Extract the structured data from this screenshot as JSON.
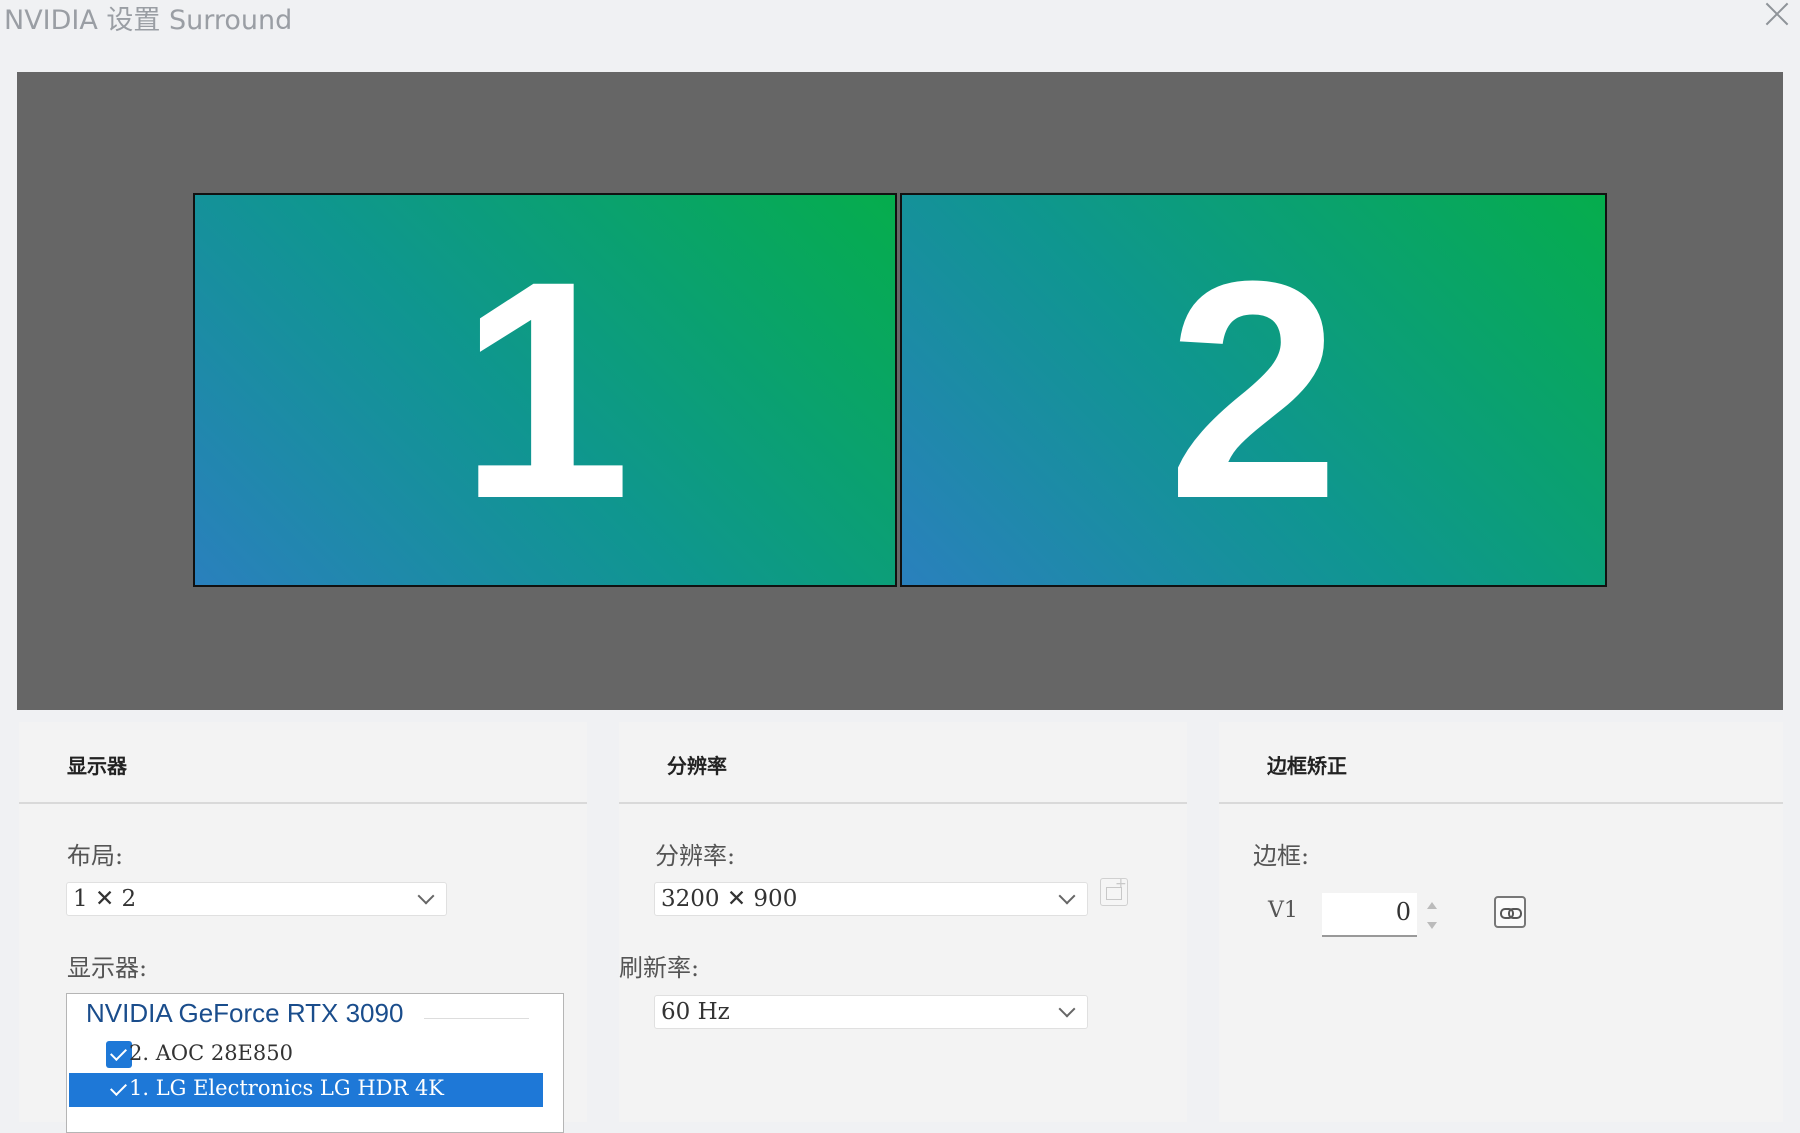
{
  "window": {
    "title": "NVIDIA 设置 Surround"
  },
  "preview": {
    "monitors": [
      {
        "number": "1"
      },
      {
        "number": "2"
      }
    ]
  },
  "display_panel": {
    "header": "显示器",
    "layout_label": "布局:",
    "layout_value": "1 ✕ 2",
    "displays_label": "显示器:",
    "gpu_name": "NVIDIA GeForce RTX 3090",
    "items": [
      {
        "label": "2. AOC 28E850",
        "checked": true,
        "selected": false
      },
      {
        "label": "1. LG Electronics LG HDR 4K",
        "checked": true,
        "selected": true
      }
    ]
  },
  "resolution_panel": {
    "header": "分辨率",
    "resolution_label": "分辨率:",
    "resolution_value": "3200 ✕ 900",
    "refresh_label": "刷新率:",
    "refresh_value": "60 Hz"
  },
  "bezel_panel": {
    "header": "边框矫正",
    "bezel_label": "边框:",
    "v1_label": "V1",
    "v1_value": "0"
  },
  "colors": {
    "selection": "#1e78d7",
    "preview_bg": "#666666",
    "monitor_gradient": [
      "#2a80bd",
      "#05ad4c"
    ]
  }
}
